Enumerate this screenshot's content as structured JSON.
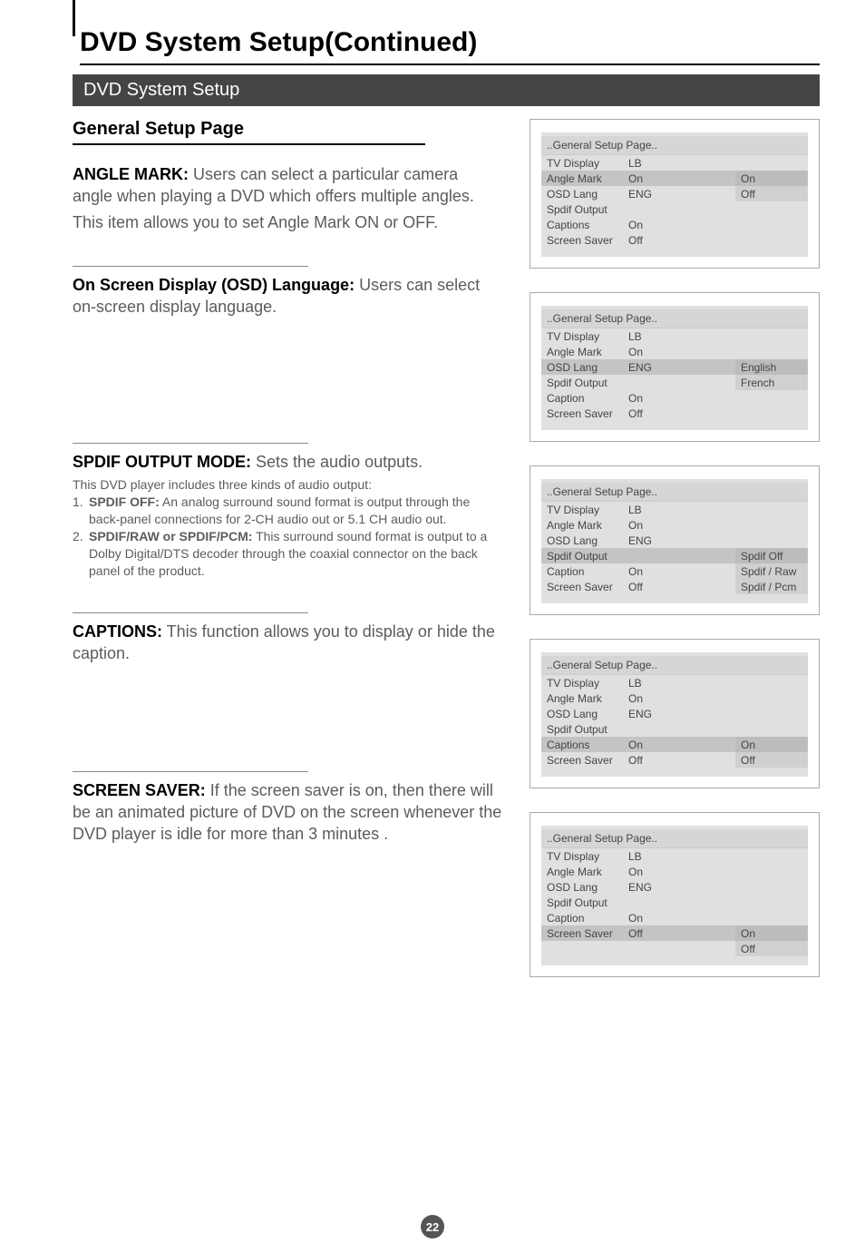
{
  "page": {
    "main_title": "DVD System Setup(Continued)",
    "sub_title": "DVD System Setup",
    "page_number": "22",
    "gsp_heading": "General Setup Page"
  },
  "sections": {
    "angle": {
      "label": "ANGLE MARK:",
      "body": " Users can select a particular camera angle when playing  a DVD which offers multiple angles.",
      "sub": "This item allows you to set Angle Mark ON or OFF."
    },
    "osd": {
      "label": "On  Screen  Display (OSD) Language:",
      "body": "  Users can select on-screen display language."
    },
    "spdif": {
      "label": "SPDIF OUTPUT MODE:",
      "body": " Sets the audio outputs.",
      "intro": "This DVD player includes three kinds of audio output:",
      "item1_num": "1.",
      "item1_label": "SPDIF OFF:",
      "item1_body": "   An analog surround sound format is output through the back-panel connections for  2-CH audio out or  5.1 CH audio out.",
      "item2_num": "2.",
      "item2_label": "SPDIF/RAW or SPDIF/PCM:",
      "item2_body": " This surround sound  format   is output to a Dolby  Digital/DTS decoder through the  coaxial connector on the  back panel of the product."
    },
    "captions": {
      "label": "CAPTIONS:",
      "body": " This function allows you to display or hide the caption."
    },
    "screensaver": {
      "label": "SCREEN SAVER:",
      "body": " If the screen saver is on, then there will be an animated picture of DVD on the screen  whenever the DVD player is idle for more than 3 minutes ."
    }
  },
  "panels": {
    "title": "..General Setup Page..",
    "p1": {
      "selected_index": 1,
      "rows": [
        {
          "lbl": "TV Display",
          "val": "LB"
        },
        {
          "lbl": "Angle Mark",
          "val": "On"
        },
        {
          "lbl": "OSD Lang",
          "val": "ENG"
        },
        {
          "lbl": "Spdif Output",
          "val": ""
        },
        {
          "lbl": "Captions",
          "val": "On"
        },
        {
          "lbl": "Screen Saver",
          "val": "Off"
        }
      ],
      "opts": [
        "On",
        "Off"
      ],
      "opts_offset_rows": 1
    },
    "p2": {
      "selected_index": 2,
      "rows": [
        {
          "lbl": "TV Display",
          "val": "LB"
        },
        {
          "lbl": "Angle Mark",
          "val": "On"
        },
        {
          "lbl": "OSD Lang",
          "val": "ENG"
        },
        {
          "lbl": "Spdif Output",
          "val": ""
        },
        {
          "lbl": "Caption",
          "val": "On"
        },
        {
          "lbl": "Screen Saver",
          "val": "Off"
        }
      ],
      "opts": [
        "English",
        "French"
      ],
      "opts_offset_rows": 2
    },
    "p3": {
      "selected_index": 3,
      "rows": [
        {
          "lbl": "TV Display",
          "val": "LB"
        },
        {
          "lbl": "Angle Mark",
          "val": "On"
        },
        {
          "lbl": "OSD Lang",
          "val": "ENG"
        },
        {
          "lbl": "Spdif Output",
          "val": ""
        },
        {
          "lbl": "Caption",
          "val": "On"
        },
        {
          "lbl": "Screen Saver",
          "val": "Off"
        }
      ],
      "opts": [
        "Spdif Off",
        "Spdif / Raw",
        "Spdif / Pcm"
      ],
      "opts_offset_rows": 3
    },
    "p4": {
      "selected_index": 4,
      "rows": [
        {
          "lbl": "TV Display",
          "val": "LB"
        },
        {
          "lbl": "Angle Mark",
          "val": "On"
        },
        {
          "lbl": "OSD Lang",
          "val": "ENG"
        },
        {
          "lbl": "Spdif Output",
          "val": ""
        },
        {
          "lbl": "Captions",
          "val": "On"
        },
        {
          "lbl": "Screen Saver",
          "val": "Off"
        }
      ],
      "opts": [
        "On",
        "Off"
      ],
      "opts_offset_rows": 4
    },
    "p5": {
      "selected_index": 5,
      "rows": [
        {
          "lbl": "TV Display",
          "val": "LB"
        },
        {
          "lbl": "Angle Mark",
          "val": "On"
        },
        {
          "lbl": "OSD Lang",
          "val": "ENG"
        },
        {
          "lbl": "Spdif Output",
          "val": ""
        },
        {
          "lbl": "Caption",
          "val": "On"
        },
        {
          "lbl": "Screen Saver",
          "val": "Off"
        }
      ],
      "opts": [
        "On",
        "Off"
      ],
      "opts_offset_rows": 5
    }
  }
}
